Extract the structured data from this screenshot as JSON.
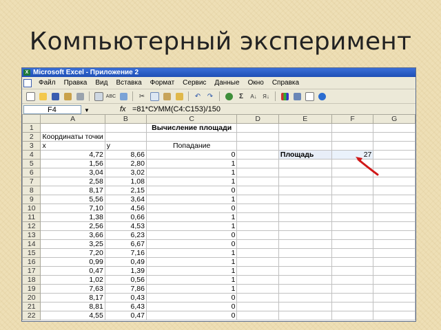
{
  "slide": {
    "title": "Компьютерный эксперимент"
  },
  "window": {
    "title": "Microsoft Excel - Приложение 2"
  },
  "menu": [
    "Файл",
    "Правка",
    "Вид",
    "Вставка",
    "Формат",
    "Сервис",
    "Данные",
    "Окно",
    "Справка"
  ],
  "toolbar": {
    "icons": [
      "new-icon",
      "open-icon",
      "save-icon",
      "permissions-icon",
      "print-icon",
      "print-preview-icon",
      "spelling-icon",
      "research-icon",
      "cut-icon",
      "copy-icon",
      "paste-icon",
      "format-painter-icon",
      "undo-icon",
      "redo-icon",
      "hyperlink-icon",
      "autosum-icon",
      "sort-asc-icon",
      "sort-desc-icon",
      "chart-wizard-icon",
      "drawing-icon",
      "zoom-icon",
      "help-icon"
    ],
    "accent": "#1f4fb5"
  },
  "formula_bar": {
    "name_box": "F4",
    "fx": "fx",
    "formula": "=81*СУММ(C4:C153)/150"
  },
  "columns": [
    "A",
    "B",
    "C",
    "D",
    "E",
    "F",
    "G"
  ],
  "rows": [
    {
      "n": "1",
      "a": "",
      "b": "",
      "c": "Вычисление площади",
      "d": "",
      "e": "",
      "f": "",
      "g": ""
    },
    {
      "n": "2",
      "a": "Координаты точки",
      "b": "",
      "c": "",
      "d": "",
      "e": "",
      "f": "",
      "g": ""
    },
    {
      "n": "3",
      "a": "x",
      "b": "y",
      "c": "Попадание",
      "d": "",
      "e": "",
      "f": "",
      "g": ""
    },
    {
      "n": "4",
      "a": "4,72",
      "b": "8,66",
      "c": "0",
      "d": "",
      "e": "Площадь",
      "f": "27",
      "g": ""
    },
    {
      "n": "5",
      "a": "1,56",
      "b": "2,80",
      "c": "1",
      "d": "",
      "e": "",
      "f": "",
      "g": ""
    },
    {
      "n": "6",
      "a": "3,04",
      "b": "3,02",
      "c": "1",
      "d": "",
      "e": "",
      "f": "",
      "g": ""
    },
    {
      "n": "7",
      "a": "2,58",
      "b": "1,08",
      "c": "1",
      "d": "",
      "e": "",
      "f": "",
      "g": ""
    },
    {
      "n": "8",
      "a": "8,17",
      "b": "2,15",
      "c": "0",
      "d": "",
      "e": "",
      "f": "",
      "g": ""
    },
    {
      "n": "9",
      "a": "5,56",
      "b": "3,64",
      "c": "1",
      "d": "",
      "e": "",
      "f": "",
      "g": ""
    },
    {
      "n": "10",
      "a": "7,10",
      "b": "4,56",
      "c": "0",
      "d": "",
      "e": "",
      "f": "",
      "g": ""
    },
    {
      "n": "11",
      "a": "1,38",
      "b": "0,66",
      "c": "1",
      "d": "",
      "e": "",
      "f": "",
      "g": ""
    },
    {
      "n": "12",
      "a": "2,56",
      "b": "4,53",
      "c": "1",
      "d": "",
      "e": "",
      "f": "",
      "g": ""
    },
    {
      "n": "13",
      "a": "3,66",
      "b": "6,23",
      "c": "0",
      "d": "",
      "e": "",
      "f": "",
      "g": ""
    },
    {
      "n": "14",
      "a": "3,25",
      "b": "6,67",
      "c": "0",
      "d": "",
      "e": "",
      "f": "",
      "g": ""
    },
    {
      "n": "15",
      "a": "7,20",
      "b": "7,16",
      "c": "1",
      "d": "",
      "e": "",
      "f": "",
      "g": ""
    },
    {
      "n": "16",
      "a": "0,99",
      "b": "0,49",
      "c": "1",
      "d": "",
      "e": "",
      "f": "",
      "g": ""
    },
    {
      "n": "17",
      "a": "0,47",
      "b": "1,39",
      "c": "1",
      "d": "",
      "e": "",
      "f": "",
      "g": ""
    },
    {
      "n": "18",
      "a": "1,02",
      "b": "0,56",
      "c": "1",
      "d": "",
      "e": "",
      "f": "",
      "g": ""
    },
    {
      "n": "19",
      "a": "7,63",
      "b": "7,86",
      "c": "1",
      "d": "",
      "e": "",
      "f": "",
      "g": ""
    },
    {
      "n": "20",
      "a": "8,17",
      "b": "0,43",
      "c": "0",
      "d": "",
      "e": "",
      "f": "",
      "g": ""
    },
    {
      "n": "21",
      "a": "8,81",
      "b": "6,43",
      "c": "0",
      "d": "",
      "e": "",
      "f": "",
      "g": ""
    },
    {
      "n": "22",
      "a": "4,55",
      "b": "0,47",
      "c": "0",
      "d": "",
      "e": "",
      "f": "",
      "g": ""
    }
  ]
}
